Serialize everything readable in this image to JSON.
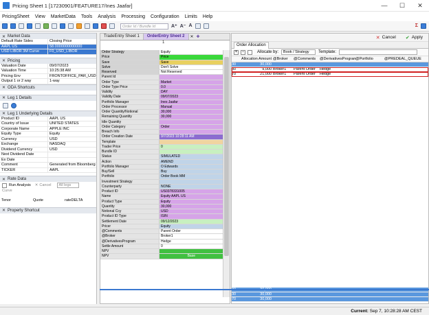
{
  "window": {
    "title": "Pricing Sheet 1 [17230901/FEATURE17/Ines Jaafar]",
    "minimize": "—",
    "maximize": "☐",
    "close": "✕"
  },
  "menu": [
    "PricingSheet",
    "View",
    "MarketData",
    "Tools",
    "Analysis",
    "Processing",
    "Configuration",
    "Limits",
    "Help"
  ],
  "toolbar": {
    "search_placeholder": "Order Id / Bundle Id"
  },
  "left": {
    "market_data": {
      "title": "Market Data",
      "rows": [
        [
          "Default Rate Sides",
          "Closing Price"
        ],
        [
          "AAPL US",
          "58.0000000000000"
        ],
        [
          "USD LIBOR 3M Curve",
          "F0_USD_LIBOR"
        ]
      ]
    },
    "pricing": {
      "title": "Pricing",
      "rows": [
        [
          "Valuation Date",
          "09/07/2023"
        ],
        [
          "Valuation Time",
          "10:25:38 AM"
        ],
        [
          "Pricing Env",
          "FRONTOFFICE_PAR_USD"
        ],
        [
          "Output 1 or 2 way",
          "1-way"
        ]
      ]
    },
    "oda": {
      "title": "ODA Shortcuts"
    },
    "leg1": {
      "title": "Leg 1 Details"
    },
    "underlying": {
      "title": "Leg 1 Underlying Details",
      "rows": [
        [
          "Product ID",
          "AAPL US"
        ],
        [
          "Country of Issue",
          "UNITED STATES"
        ],
        [
          "Corporate Name",
          "APPLE INC"
        ],
        [
          "Equity Type",
          "Equity"
        ],
        [
          "Currency",
          "USD"
        ],
        [
          "Exchange",
          "NASDAQ"
        ],
        [
          "Dividend Currency",
          "USD"
        ],
        [
          "Next Dividend Date",
          ""
        ],
        [
          "Ex Date",
          ""
        ],
        [
          "Comment",
          "Generated from Bloomberg"
        ],
        [
          "TICKER",
          "AAPL"
        ]
      ]
    },
    "rate": {
      "title": "Rate Data",
      "run_analysis": "Run Analysis",
      "cancel": "Cancel",
      "all_legs": "All legs",
      "curve": "Curve",
      "rows": [
        [
          "Tenor",
          "Quote",
          "rateDELTA"
        ]
      ]
    },
    "property": {
      "title": "Property Shortcut"
    }
  },
  "center": {
    "tabs": [
      "TradeEntry Sheet 1",
      "OrderEntry Sheet 2"
    ],
    "page": "1",
    "rows": [
      [
        "Order Strategy",
        "Equity",
        "#ffffff"
      ],
      [
        "Price",
        "Price",
        "#3ad83a"
      ],
      [
        "Save",
        "Save",
        "#e8d060"
      ],
      [
        "Solve",
        "Don't Solve",
        "#ffffff"
      ],
      [
        "Reserved",
        "Not Reserved",
        "#ffffff"
      ],
      [
        "Parent Id",
        "",
        "#d6a4e8"
      ],
      [
        "Order Type",
        "Market",
        "#d6a4e8"
      ],
      [
        "Order Type Price",
        "0.0",
        "#d6a4e8"
      ],
      [
        "Validity",
        "DAY",
        "#d6a4e8"
      ],
      [
        "Validity Date",
        "09/07/2023",
        "#d6a4e8"
      ],
      [
        "Portfolio Manager",
        "Ines Jaafar",
        "#d6a4e8"
      ],
      [
        "Order Processor",
        "Manual",
        "#d6a4e8"
      ],
      [
        "Order Quantity/Notional",
        "30,000",
        "#d6a4e8"
      ],
      [
        "Remaining Quantity",
        "30,000",
        "#d6a4e8"
      ],
      [
        "Idle Quantity",
        "",
        "#d6a4e8"
      ],
      [
        "Order Category",
        "Order",
        "#d6a4e8"
      ],
      [
        "Breach Info",
        "",
        "#d6a4e8"
      ],
      [
        "Order Creation Date",
        "9/7/2023 10:28:11 AM",
        "#8c6cd0"
      ],
      [
        "Template",
        "",
        "#f0d4a0"
      ],
      [
        "Trader Price",
        "0",
        "#c8f0c0"
      ],
      [
        "Bundle ID",
        "",
        "#c8f0c0"
      ],
      [
        "Status",
        "SIMULATED",
        "#c0d4e8"
      ],
      [
        "Action",
        "AMEND",
        "#c0d4e8"
      ],
      [
        "Portfolio Manager",
        "O Edwards",
        "#c0d4e8"
      ],
      [
        "Buy/Sell",
        "Buy",
        "#c0d4e8"
      ],
      [
        "Portfolio",
        "Order Book MM",
        "#c0d4e8"
      ],
      [
        "Investment Strategy",
        "",
        "#c0d4e8"
      ],
      [
        "Counterparty",
        "NONE",
        "#c0d4e8"
      ],
      [
        "Product ID",
        "US0378331005",
        "#d6a4e8"
      ],
      [
        "Name",
        "Equity AAPL US",
        "#d6a4e8"
      ],
      [
        "Product Type",
        "Equity",
        "#d6a4e8"
      ],
      [
        "Quantity",
        "30,000",
        "#d6a4e8"
      ],
      [
        "Notional Ccy",
        "USD",
        "#d6a4e8"
      ],
      [
        "Product ID Type",
        "ISIN",
        "#d6a4e8"
      ],
      [
        "Settlement Date",
        "09/12/2023",
        "#c8f0c0"
      ],
      [
        "Pricer",
        "Equity",
        "#c0d4e8"
      ],
      [
        "@Comments",
        "Parent Order",
        "#ffffff"
      ],
      [
        "@Broker",
        "Broker1",
        "#ffffff"
      ],
      [
        "@DerivativesProgram",
        "Hedge",
        "#ffffff"
      ],
      [
        "Settle Amount",
        "0",
        "#ffffff"
      ],
      [
        "NPV",
        "",
        "#40c040"
      ],
      [
        "NPV",
        "Base",
        "#40c040"
      ]
    ]
  },
  "right": {
    "cancel": "Cancel",
    "apply": "Apply",
    "tab": "Order Allocation",
    "allocate_by_label": "Allocate by:",
    "allocate_by": "Book / Strategy",
    "template_label": "Template:",
    "headers": [
      "",
      "Allocation Amount",
      "@Broker",
      "@Comments",
      "@DerivativesProgram",
      "@Portfolio",
      "@PREDEAL_QUEUE"
    ],
    "rows": [
      [
        "30",
        "30,000",
        "",
        "",
        "",
        "",
        "",
        "blue"
      ],
      [
        "30",
        "9,000",
        "Broker1",
        "Parent Order",
        "Hedge",
        "",
        "",
        "red"
      ],
      [
        "70",
        "21,000",
        "Broker1",
        "Parent Order",
        "Hedge",
        "",
        "",
        "red"
      ]
    ],
    "bottom_rows": [
      [
        "30",
        "30,000"
      ],
      [
        "30",
        "30,000"
      ],
      [
        "70",
        "30,000"
      ]
    ]
  },
  "status": {
    "label": "Current:",
    "value": "Sep 7, 10:28:28 AM CEST"
  }
}
